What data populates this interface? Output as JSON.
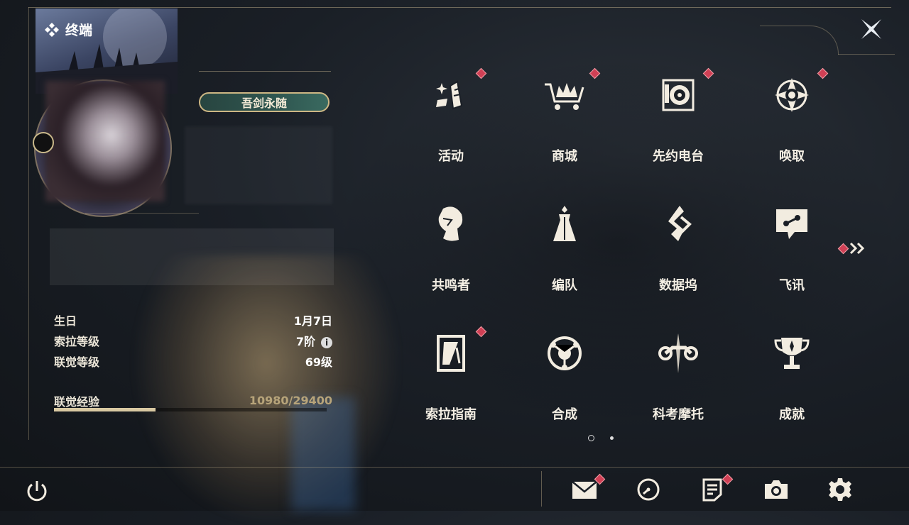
{
  "header": {
    "title": "终端"
  },
  "profile": {
    "badge_text": "吾剑永随",
    "stats": [
      {
        "label": "生日",
        "value": "1月7日"
      },
      {
        "label": "索拉等级",
        "value": "7阶"
      },
      {
        "label": "联觉等级",
        "value": "69级"
      }
    ],
    "exp": {
      "label": "联觉经验",
      "value": "10980/29400",
      "progress": 0.3735
    }
  },
  "menu": {
    "items": [
      {
        "label": "活动",
        "icon": "activity-icon",
        "notify": true
      },
      {
        "label": "商城",
        "icon": "shop-icon",
        "notify": true
      },
      {
        "label": "先约电台",
        "icon": "radio-icon",
        "notify": true
      },
      {
        "label": "唤取",
        "icon": "summon-icon",
        "notify": true
      },
      {
        "label": "共鸣者",
        "icon": "resonator-icon",
        "notify": false
      },
      {
        "label": "编队",
        "icon": "team-icon",
        "notify": false
      },
      {
        "label": "数据坞",
        "icon": "data-bank-icon",
        "notify": false
      },
      {
        "label": "飞讯",
        "icon": "message-icon",
        "notify": false
      },
      {
        "label": "索拉指南",
        "icon": "guide-icon",
        "notify": true
      },
      {
        "label": "合成",
        "icon": "synthesis-icon",
        "notify": false
      },
      {
        "label": "科考摩托",
        "icon": "motorcycle-icon",
        "notify": false
      },
      {
        "label": "成就",
        "icon": "trophy-icon",
        "notify": false
      }
    ],
    "pages": 2,
    "current_page": 1
  },
  "colors": {
    "accent": "#cdb784",
    "notify": "#d04055",
    "text": "#f4efe4"
  }
}
